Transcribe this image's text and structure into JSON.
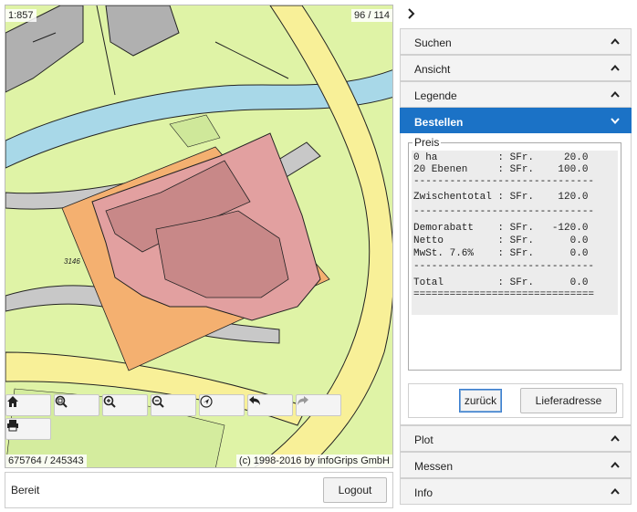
{
  "map": {
    "scale": "1:857",
    "pages": "96 / 114",
    "coordinates": "675764 / 245343",
    "copyright": "(c) 1998-2016 by infoGrips GmbH",
    "parcel_label": "3146"
  },
  "toolbar": {
    "home_icon": "home-icon",
    "zoom_extent_icon": "zoom-extent-icon",
    "zoom_in_icon": "zoom-in-icon",
    "zoom_out_icon": "zoom-out-icon",
    "locate_icon": "locate-icon",
    "undo_icon": "undo-icon",
    "redo_icon": "redo-icon",
    "print_icon": "print-icon"
  },
  "status": {
    "text": "Bereit",
    "logout_label": "Logout"
  },
  "sidebar": {
    "collapse_icon": "chevron-right-icon",
    "sections": {
      "suchen": "Suchen",
      "ansicht": "Ansicht",
      "legende": "Legende",
      "bestellen": "Bestellen",
      "plot": "Plot",
      "messen": "Messen",
      "info": "Info"
    },
    "accent_color": "#1b72c6"
  },
  "order": {
    "legend": "Preis",
    "lines": [
      "0 ha          : SFr.     20.0",
      "20 Ebenen     : SFr.    100.0",
      "------------------------------",
      "Zwischentotal : SFr.    120.0",
      "------------------------------",
      "Demorabatt    : SFr.   -120.0",
      "Netto         : SFr.      0.0",
      "MwSt. 7.6%    : SFr.      0.0",
      "------------------------------",
      "Total         : SFr.      0.0",
      "=============================="
    ],
    "back_label": "zurück",
    "delivery_label": "Lieferadresse"
  }
}
